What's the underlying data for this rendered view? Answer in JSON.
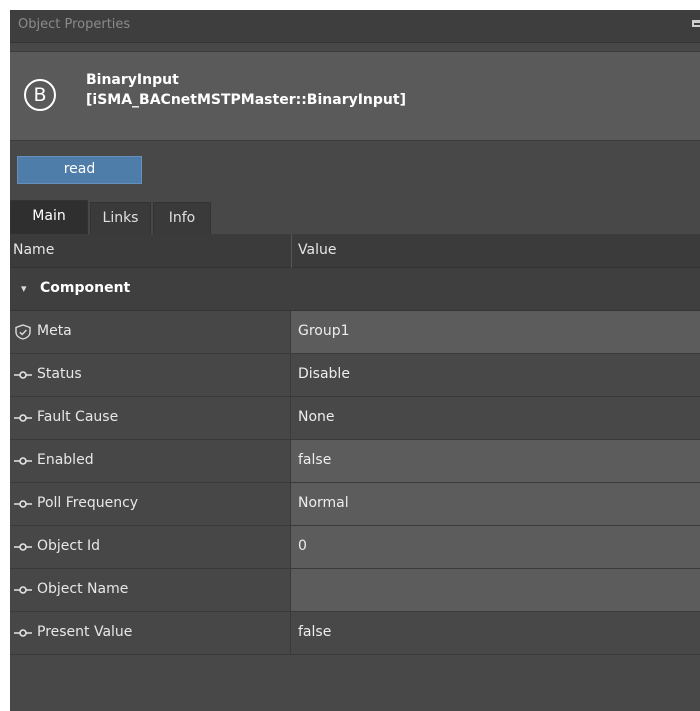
{
  "panel": {
    "title": "Object Properties",
    "dock_icon": "dock-icon"
  },
  "object": {
    "icon": "binary-b-circle-icon",
    "icon_letter": "B",
    "name": "BinaryInput",
    "type": "[iSMA_BACnetMSTPMaster::BinaryInput]"
  },
  "actions": {
    "read_label": "read"
  },
  "tabs": [
    {
      "label": "Main",
      "active": true
    },
    {
      "label": "Links",
      "active": false
    },
    {
      "label": "Info",
      "active": false
    }
  ],
  "grid": {
    "col_name": "Name",
    "col_value": "Value",
    "group_label": "Component",
    "rows": [
      {
        "name": "Meta",
        "value": "Group1",
        "icon": "shield-check-icon",
        "editable": true
      },
      {
        "name": "Status",
        "value": "Disable",
        "icon": "slot-link-icon",
        "editable": false
      },
      {
        "name": "Fault Cause",
        "value": "None",
        "icon": "slot-link-icon",
        "editable": false
      },
      {
        "name": "Enabled",
        "value": "false",
        "icon": "slot-link-icon",
        "editable": true
      },
      {
        "name": "Poll Frequency",
        "value": "Normal",
        "icon": "slot-link-icon",
        "editable": true
      },
      {
        "name": "Object Id",
        "value": "0",
        "icon": "slot-link-icon",
        "editable": true
      },
      {
        "name": "Object Name",
        "value": "",
        "icon": "slot-link-icon",
        "editable": true
      },
      {
        "name": "Present Value",
        "value": "false",
        "icon": "slot-link-icon",
        "editable": false
      }
    ]
  },
  "colors": {
    "panel_bg": "#484848",
    "button_accent": "#4f7daa",
    "header_card": "#5a5a5a",
    "editable_cell": "#5c5c5c"
  }
}
